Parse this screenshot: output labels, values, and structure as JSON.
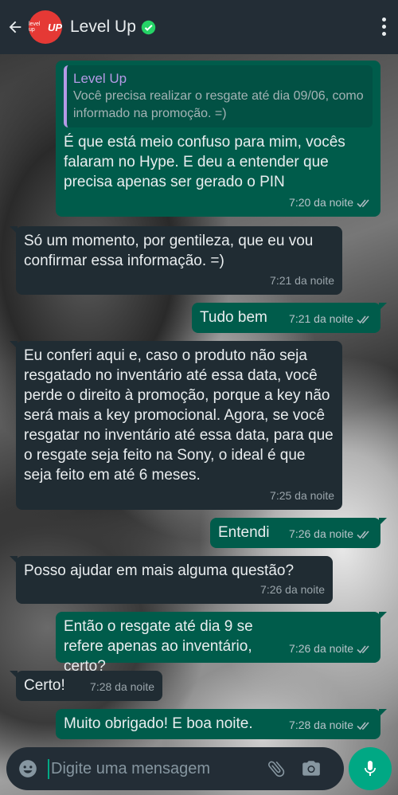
{
  "contact": {
    "name": "Level Up",
    "avatar_small": "level up",
    "avatar_big": "UP"
  },
  "composer": {
    "placeholder": "Digite uma mensagem"
  },
  "messages": [
    {
      "quote_author": "Level Up",
      "quote_text": "Você precisa realizar o resgate até dia 09/06, como informado na promoção. =)",
      "text": "É que está meio confuso para mim, vocês falaram no Hype. E deu a entender que precisa apenas ser gerado o PIN",
      "time": "7:20 da noite"
    },
    {
      "text": "Só um momento, por gentileza, que eu vou confirmar essa informação. =)",
      "time": "7:21 da noite"
    },
    {
      "text": "Tudo bem",
      "time": "7:21 da noite"
    },
    {
      "text": "Eu conferi aqui e, caso o produto não seja resgatado no inventário até essa data, você perde o direito à promoção, porque a key não será mais a key promocional. Agora, se você resgatar no inventário até essa data, para que o resgate seja feito na Sony, o ideal é que seja feito em até 6 meses.",
      "time": "7:25 da noite"
    },
    {
      "text": "Entendi",
      "time": "7:26 da noite"
    },
    {
      "text": "Posso ajudar em mais alguma questão?",
      "time": "7:26 da noite"
    },
    {
      "text": "Então o resgate até dia 9 se refere apenas ao inventário, certo?",
      "time": "7:26 da noite"
    },
    {
      "text": "Certo!",
      "time": "7:28 da noite"
    },
    {
      "text": "Muito obrigado! E boa noite.",
      "time": "7:28 da noite"
    }
  ],
  "colors": {
    "header": "#232d36",
    "outgoing": "#005c4b",
    "incoming": "#202c33",
    "accent": "#00a884",
    "quote_bar": "#b59ae6",
    "avatar": "#e53935"
  },
  "icons": [
    "back-arrow-icon",
    "verified-icon",
    "more-vertical-icon",
    "double-check-icon",
    "emoji-icon",
    "paperclip-icon",
    "camera-icon",
    "microphone-icon"
  ]
}
